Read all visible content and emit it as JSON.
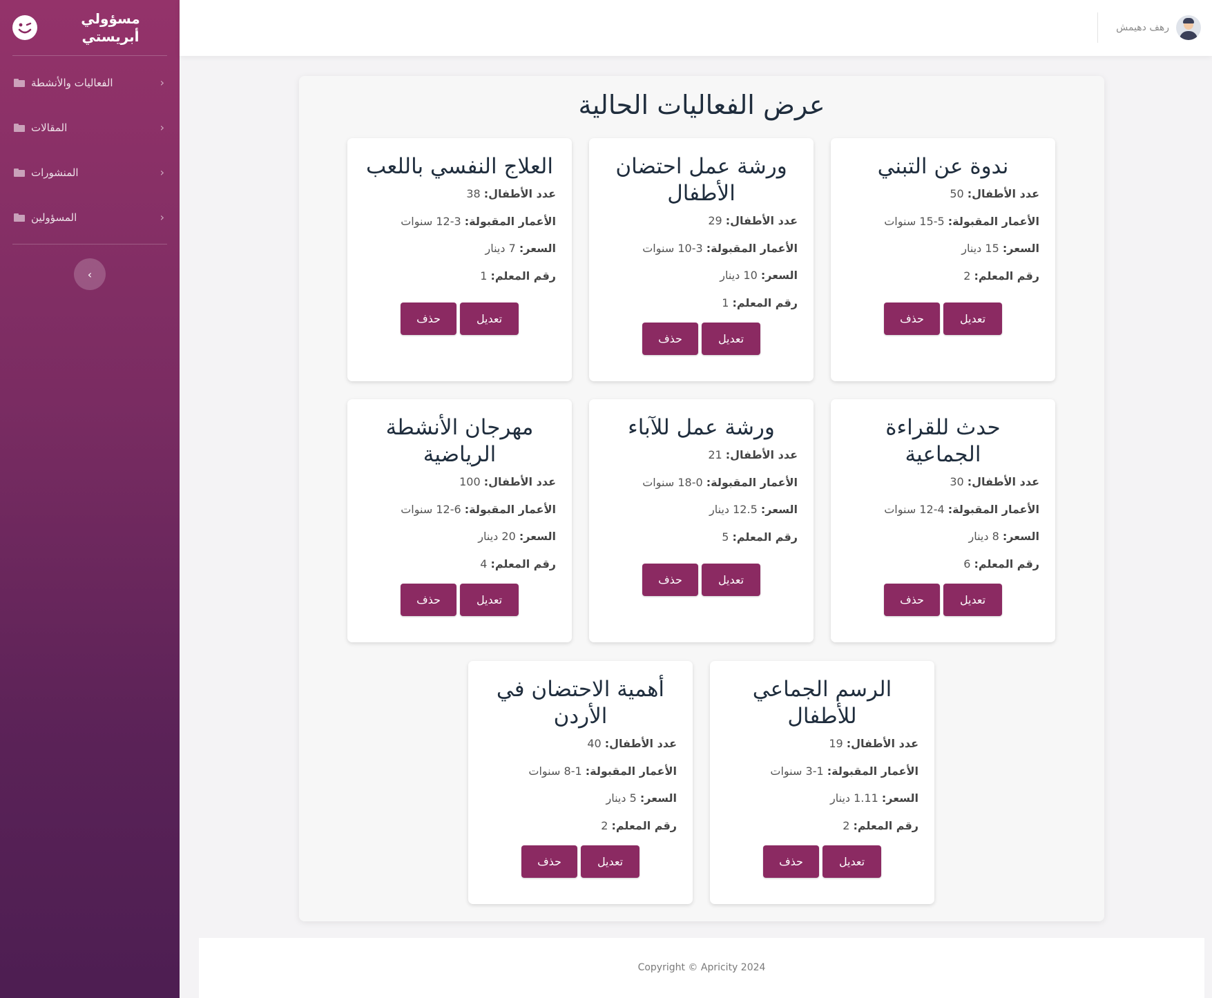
{
  "sidebar": {
    "brand": "مسؤولي أبريستي",
    "items": [
      {
        "label": "الفعاليات والأنشطة"
      },
      {
        "label": "المقالات"
      },
      {
        "label": "المنشورات"
      },
      {
        "label": "المسؤولين"
      }
    ],
    "toggle_icon": "chevron-left-icon"
  },
  "topbar": {
    "user_name": "رهف دهيمش"
  },
  "main": {
    "title": "عرض الفعاليات الحالية",
    "labels": {
      "children": "عدد الأطفال:",
      "ages": "الأعمار المقبولة:",
      "price": "السعر:",
      "teacher": "رقم المعلم:",
      "edit": "تعديل",
      "delete": "حذف"
    },
    "events": [
      {
        "title": "ندوة عن التبني",
        "children": "50",
        "ages": "5-15 سنوات",
        "price": "15 دينار",
        "teacher": "2"
      },
      {
        "title": "ورشة عمل احتضان الأطفال",
        "children": "29",
        "ages": "3-10 سنوات",
        "price": "10 دينار",
        "teacher": "1"
      },
      {
        "title": "العلاج النفسي باللعب",
        "children": "38",
        "ages": "3-12 سنوات",
        "price": "7 دينار",
        "teacher": "1"
      },
      {
        "title": "حدث للقراءة الجماعية",
        "children": "30",
        "ages": "4-12 سنوات",
        "price": "8 دينار",
        "teacher": "6"
      },
      {
        "title": "ورشة عمل للآباء",
        "children": "21",
        "ages": "0-18 سنوات",
        "price": "12.5 دينار",
        "teacher": "5"
      },
      {
        "title": "مهرجان الأنشطة الرياضية",
        "children": "100",
        "ages": "6-12 سنوات",
        "price": "20 دينار",
        "teacher": "4"
      },
      {
        "title": "الرسم الجماعي للأطفال",
        "children": "19",
        "ages": "1-3 سنوات",
        "price": "1.11 دينار",
        "teacher": "2"
      },
      {
        "title": "أهمية الاحتضان في الأردن",
        "children": "40",
        "ages": "1-8 سنوات",
        "price": "5 دينار",
        "teacher": "2"
      }
    ]
  },
  "footer": {
    "text": "Copyright © Apricity 2024"
  },
  "colors": {
    "accent": "#8b2a62",
    "sidebar_top": "#94336a",
    "sidebar_bottom": "#4d1e52"
  }
}
